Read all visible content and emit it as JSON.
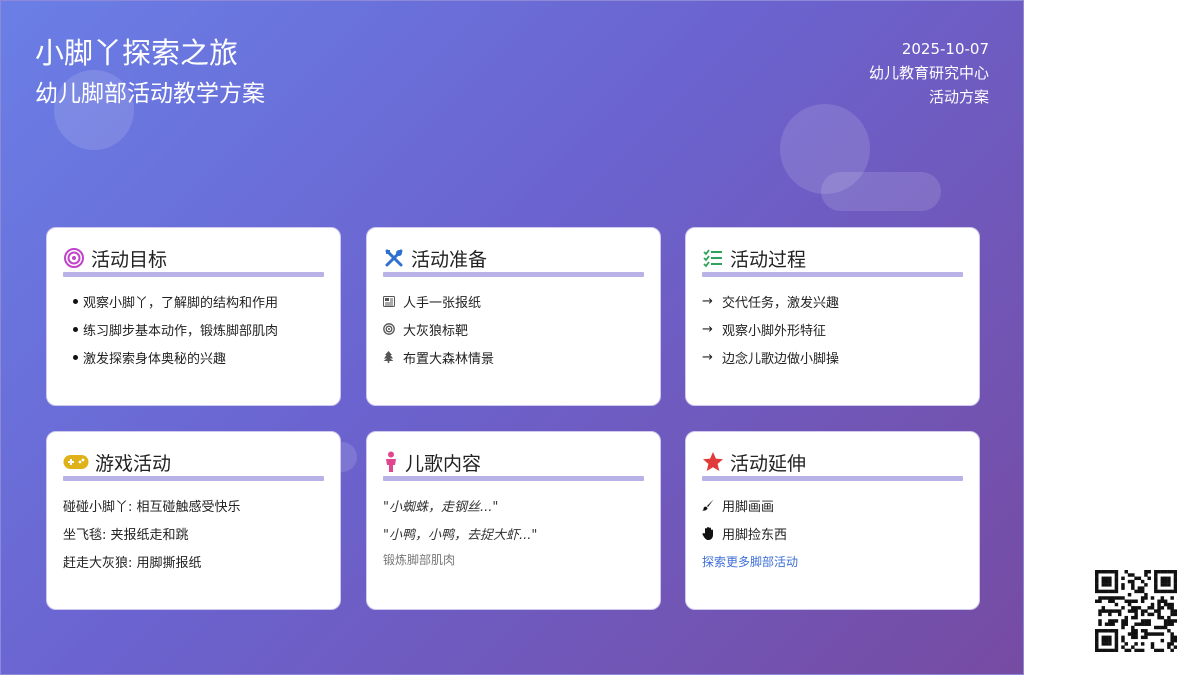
{
  "header": {
    "title": "小脚丫探索之旅",
    "subtitle": "幼儿脚部活动教学方案",
    "date": "2025-10-07",
    "org": "幼儿教育研究中心",
    "doc_type": "活动方案"
  },
  "cards": {
    "goals": {
      "title": "活动目标",
      "icon": "target-icon",
      "items": [
        "观察小脚丫，了解脚的结构和作用",
        "练习脚步基本动作，锻炼脚部肌肉",
        "激发探索身体奥秘的兴趣"
      ]
    },
    "prep": {
      "title": "活动准备",
      "icon": "tools-icon",
      "items": [
        "人手一张报纸",
        "大灰狼标靶",
        "布置大森林情景"
      ]
    },
    "process": {
      "title": "活动过程",
      "icon": "checklist-icon",
      "arrow": "→",
      "items": [
        "交代任务，激发兴趣",
        "观察小脚外形特征",
        "边念儿歌边做小脚操"
      ]
    },
    "games": {
      "title": "游戏活动",
      "icon": "gamepad-icon",
      "items": [
        "碰碰小脚丫: 相互碰触感受快乐",
        "坐飞毯: 夹报纸走和跳",
        "赶走大灰狼: 用脚撕报纸"
      ]
    },
    "songs": {
      "title": "儿歌内容",
      "icon": "child-icon",
      "items": [
        "\"小蜘蛛，走钢丝...\"",
        "\"小鸭，小鸭，去捉大虾...\""
      ],
      "note": "锻炼脚部肌肉"
    },
    "extend": {
      "title": "活动延伸",
      "icon": "star-icon",
      "items": [
        "用脚画画",
        "用脚捡东西"
      ],
      "link": "探索更多脚部活动"
    }
  },
  "colors": {
    "gradient_start": "#6a7fe6",
    "gradient_end": "#764ba2",
    "rule": "#b8b2e6",
    "goal_icon": "#c043c9",
    "tools_icon": "#2f6fd0",
    "check_icon": "#2fa35a",
    "game_icon": "#e0b21a",
    "child_icon": "#e0468f",
    "star_icon": "#e03a3a",
    "link": "#3d6fd6"
  },
  "qr_code": "qr-code-icon"
}
